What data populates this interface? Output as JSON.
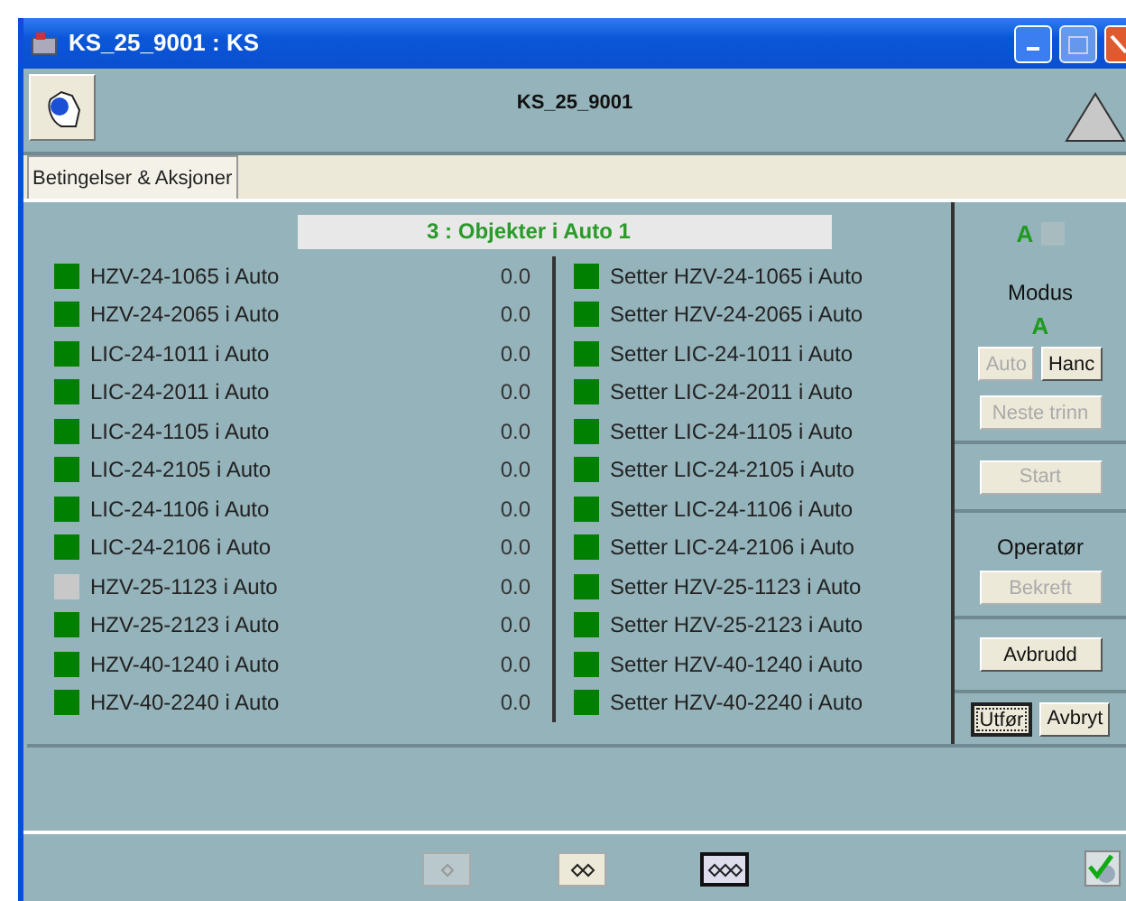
{
  "window": {
    "title": "KS_25_9001 : KS"
  },
  "header": {
    "title": "KS_25_9001"
  },
  "tabs": [
    {
      "label": "Betingelser & Aksjoner",
      "selected": true
    }
  ],
  "panel": {
    "heading": "3 : Objekter i Auto 1",
    "conditions": [
      {
        "label": "HZV-24-1065 i Auto",
        "value": "0.0",
        "color": "#008000"
      },
      {
        "label": "HZV-24-2065 i Auto",
        "value": "0.0",
        "color": "#008000"
      },
      {
        "label": "LIC-24-1011 i Auto",
        "value": "0.0",
        "color": "#008000"
      },
      {
        "label": "LIC-24-2011 i Auto",
        "value": "0.0",
        "color": "#008000"
      },
      {
        "label": "LIC-24-1105 i Auto",
        "value": "0.0",
        "color": "#008000"
      },
      {
        "label": "LIC-24-2105 i Auto",
        "value": "0.0",
        "color": "#008000"
      },
      {
        "label": "LIC-24-1106 i Auto",
        "value": "0.0",
        "color": "#008000"
      },
      {
        "label": "LIC-24-2106 i Auto",
        "value": "0.0",
        "color": "#008000"
      },
      {
        "label": "HZV-25-1123 i Auto",
        "value": "0.0",
        "color": "#c8c8c8"
      },
      {
        "label": "HZV-25-2123 i Auto",
        "value": "0.0",
        "color": "#008000"
      },
      {
        "label": "HZV-40-1240 i Auto",
        "value": "0.0",
        "color": "#008000"
      },
      {
        "label": "HZV-40-2240 i Auto",
        "value": "0.0",
        "color": "#008000"
      }
    ],
    "actions": [
      {
        "label": "Setter HZV-24-1065 i Auto",
        "color": "#008000"
      },
      {
        "label": "Setter HZV-24-2065 i Auto",
        "color": "#008000"
      },
      {
        "label": "Setter LIC-24-1011 i Auto",
        "color": "#008000"
      },
      {
        "label": "Setter LIC-24-2011 i Auto",
        "color": "#008000"
      },
      {
        "label": "Setter LIC-24-1105 i Auto",
        "color": "#008000"
      },
      {
        "label": "Setter LIC-24-2105 i Auto",
        "color": "#008000"
      },
      {
        "label": "Setter LIC-24-1106 i Auto",
        "color": "#008000"
      },
      {
        "label": "Setter LIC-24-2106 i Auto",
        "color": "#008000"
      },
      {
        "label": "Setter HZV-25-1123 i Auto",
        "color": "#008000"
      },
      {
        "label": "Setter HZV-25-2123 i Auto",
        "color": "#008000"
      },
      {
        "label": "Setter HZV-40-1240 i Auto",
        "color": "#008000"
      },
      {
        "label": "Setter HZV-40-2240 i Auto",
        "color": "#008000"
      }
    ]
  },
  "side": {
    "indicator": "A",
    "modus_label": "Modus",
    "modus_value": "A",
    "mode_buttons": [
      {
        "label": "Auto",
        "disabled": true
      },
      {
        "label": "Hanc",
        "disabled": false
      }
    ],
    "next_button": {
      "label": "Neste trinn",
      "disabled": true
    },
    "start_button": {
      "label": "Start",
      "disabled": true
    },
    "operator_label": "Operatør",
    "confirm_button": {
      "label": "Bekreft",
      "disabled": true
    },
    "abort_button": {
      "label": "Avbrudd",
      "disabled": false
    },
    "final_buttons": [
      {
        "label": "Utfør",
        "focused": true
      },
      {
        "label": "Avbryt",
        "focused": false
      }
    ]
  },
  "footer": {
    "views": [
      {
        "selected": false,
        "disabled": true
      },
      {
        "selected": false,
        "disabled": false
      },
      {
        "selected": true,
        "disabled": false
      }
    ]
  }
}
